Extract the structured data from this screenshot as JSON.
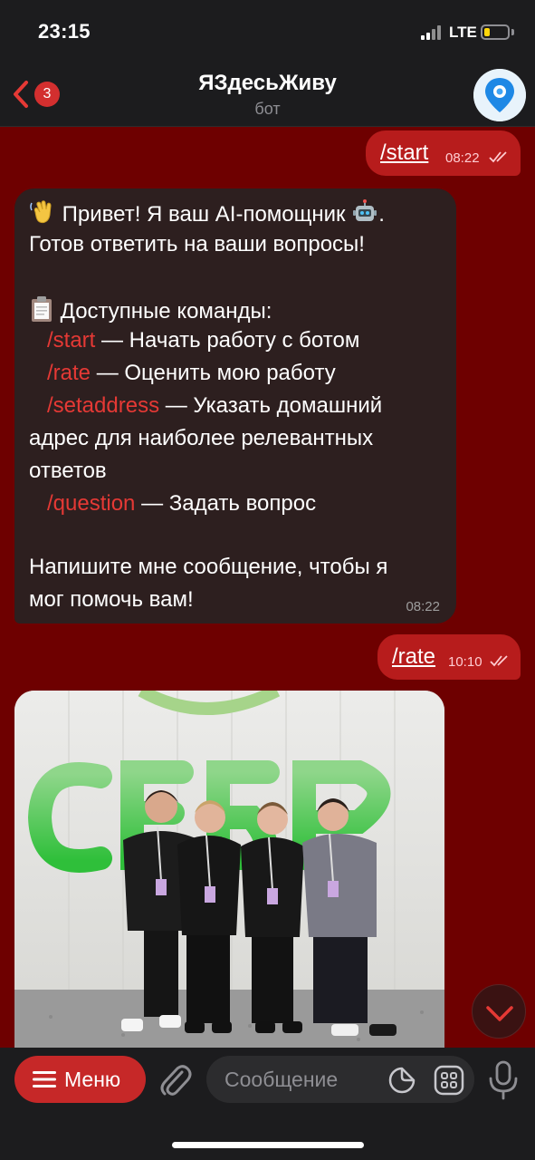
{
  "status_bar": {
    "time": "23:15",
    "network": "LTE"
  },
  "header": {
    "back_badge": "3",
    "title": "ЯЗдесьЖиву",
    "subtitle": "бот"
  },
  "messages": {
    "out1": {
      "text": "/start",
      "time": "08:22"
    },
    "bot": {
      "line1": " Привет! Я ваш AI-помощник ",
      "line1_end": ".",
      "line2": "Готов ответить на ваши вопросы!",
      "line4": " Доступные команды:",
      "cmd_start": "/start",
      "cmd_start_desc": " — Начать работу с ботом",
      "cmd_rate": "/rate",
      "cmd_rate_desc": " — Оценить мою работу",
      "cmd_setaddress": "/setaddress",
      "cmd_setaddress_desc": " — Указать домашний",
      "line8": "адрес для наиболее релевантных",
      "line9": "ответов",
      "cmd_question": "/question",
      "cmd_question_desc": " — Задать вопрос",
      "line12": "Напишите мне сообщение, чтобы я",
      "line13": "мог помочь вам!",
      "time": "08:22"
    },
    "out2": {
      "text": "/rate",
      "time": "10:10"
    }
  },
  "input_bar": {
    "menu_label": "Меню",
    "placeholder": "Сообщение"
  },
  "icons": {
    "back": "chevron-left-icon",
    "avatar": "location-pin-icon",
    "read": "double-check-icon",
    "menu": "hamburger-icon",
    "attach": "paperclip-icon",
    "sticker": "sticker-icon",
    "keyboard": "bot-keyboard-icon",
    "mic": "microphone-icon",
    "scroll": "chevron-down-icon"
  },
  "colors": {
    "accent": "#c62828",
    "chat_background": "#6e0000",
    "outgoing_bubble": "#b71c1c",
    "incoming_bubble": "#2d1f1f",
    "link": "#e53935"
  }
}
